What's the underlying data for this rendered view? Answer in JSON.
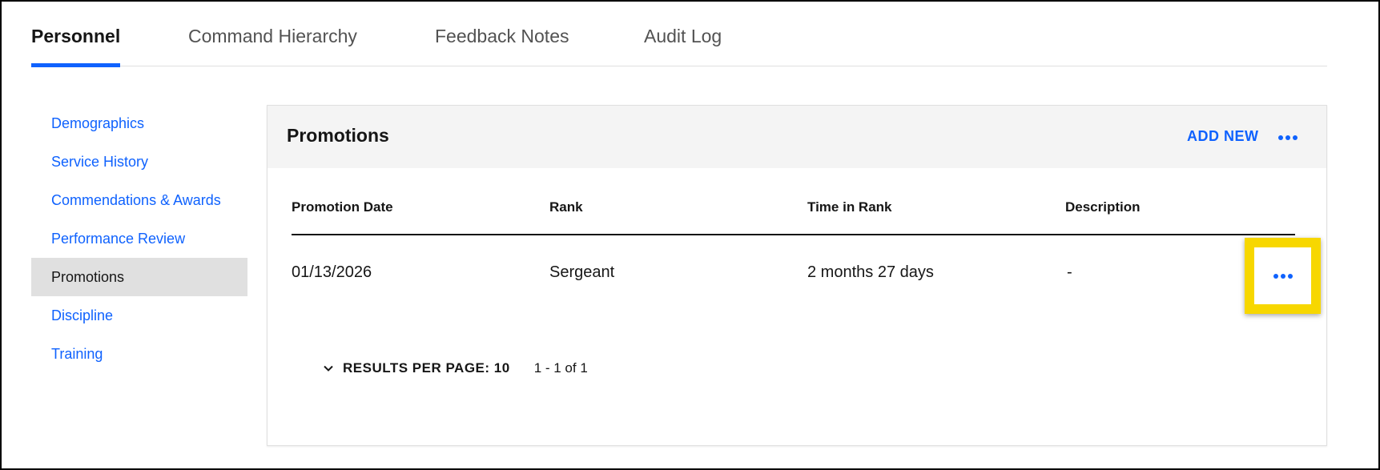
{
  "tabs": [
    {
      "label": "Personnel",
      "active": true
    },
    {
      "label": "Command Hierarchy",
      "active": false
    },
    {
      "label": "Feedback Notes",
      "active": false
    },
    {
      "label": "Audit Log",
      "active": false
    }
  ],
  "sidebar": {
    "items": [
      {
        "label": "Demographics",
        "selected": false
      },
      {
        "label": "Service History",
        "selected": false
      },
      {
        "label": "Commendations & Awards",
        "selected": false
      },
      {
        "label": "Performance Review",
        "selected": false
      },
      {
        "label": "Promotions",
        "selected": true
      },
      {
        "label": "Discipline",
        "selected": false
      },
      {
        "label": "Training",
        "selected": false
      }
    ]
  },
  "card": {
    "title": "Promotions",
    "add_new_label": "ADD NEW",
    "overflow_icon": "overflow-menu-horizontal-icon"
  },
  "table": {
    "columns": [
      "Promotion Date",
      "Rank",
      "Time in Rank",
      "Description"
    ],
    "rows": [
      {
        "promotion_date": "01/13/2026",
        "rank": "Sergeant",
        "time_in_rank": "2 months 27 days",
        "description": "-"
      }
    ]
  },
  "pagination": {
    "results_per_page_label": "RESULTS PER PAGE: 10",
    "range": "1 - 1 of 1",
    "chevron_icon": "chevron-down-icon"
  },
  "colors": {
    "accent": "#0f62fe",
    "highlight": "#f7d700",
    "selected_bg": "#e0e0e0",
    "header_bg": "#f4f4f4"
  }
}
